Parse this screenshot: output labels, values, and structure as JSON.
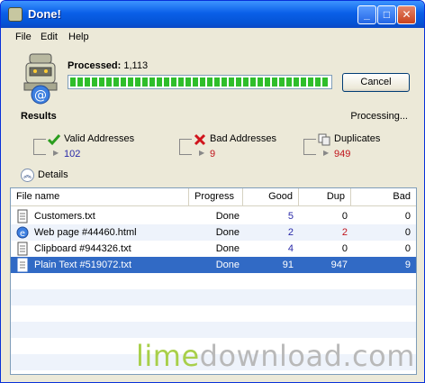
{
  "window": {
    "title": "Done!"
  },
  "menu": [
    "File",
    "Edit",
    "Help"
  ],
  "progress": {
    "label": "Processed:",
    "count": "1,113",
    "fraction": 1.0,
    "cancel_label": "Cancel"
  },
  "results": {
    "title": "Results",
    "status": "Processing..."
  },
  "stats": [
    {
      "label": "Valid Addresses",
      "value": "102",
      "color": "#2a2aa8",
      "icon": "check-icon"
    },
    {
      "label": "Bad Addresses",
      "value": "9",
      "color": "#c0141c",
      "icon": "x-icon"
    },
    {
      "label": "Duplicates",
      "value": "949",
      "color": "#c0141c",
      "icon": "duplicates-icon"
    }
  ],
  "details_label": "Details",
  "table": {
    "columns": [
      "File name",
      "Progress",
      "Good",
      "Dup",
      "Bad"
    ],
    "rows": [
      {
        "name": "Customers.txt",
        "progress": "Done",
        "good": "5",
        "dup": "0",
        "bad": "0",
        "icon": "text-file-icon"
      },
      {
        "name": "Web page #44460.html",
        "progress": "Done",
        "good": "2",
        "dup": "2",
        "bad": "0",
        "icon": "web-page-icon"
      },
      {
        "name": "Clipboard #944326.txt",
        "progress": "Done",
        "good": "4",
        "dup": "0",
        "bad": "0",
        "icon": "text-file-icon"
      },
      {
        "name": "Plain Text #519072.txt",
        "progress": "Done",
        "good": "91",
        "dup": "947",
        "bad": "9",
        "icon": "text-file-icon"
      }
    ]
  },
  "watermark": {
    "part1": "lime",
    "part2": "download.com"
  },
  "colors": {
    "good": "#2a2aa8",
    "dup": "#c0141c",
    "selection": "#316ac5",
    "progress_fill": "#2fbe2a"
  }
}
